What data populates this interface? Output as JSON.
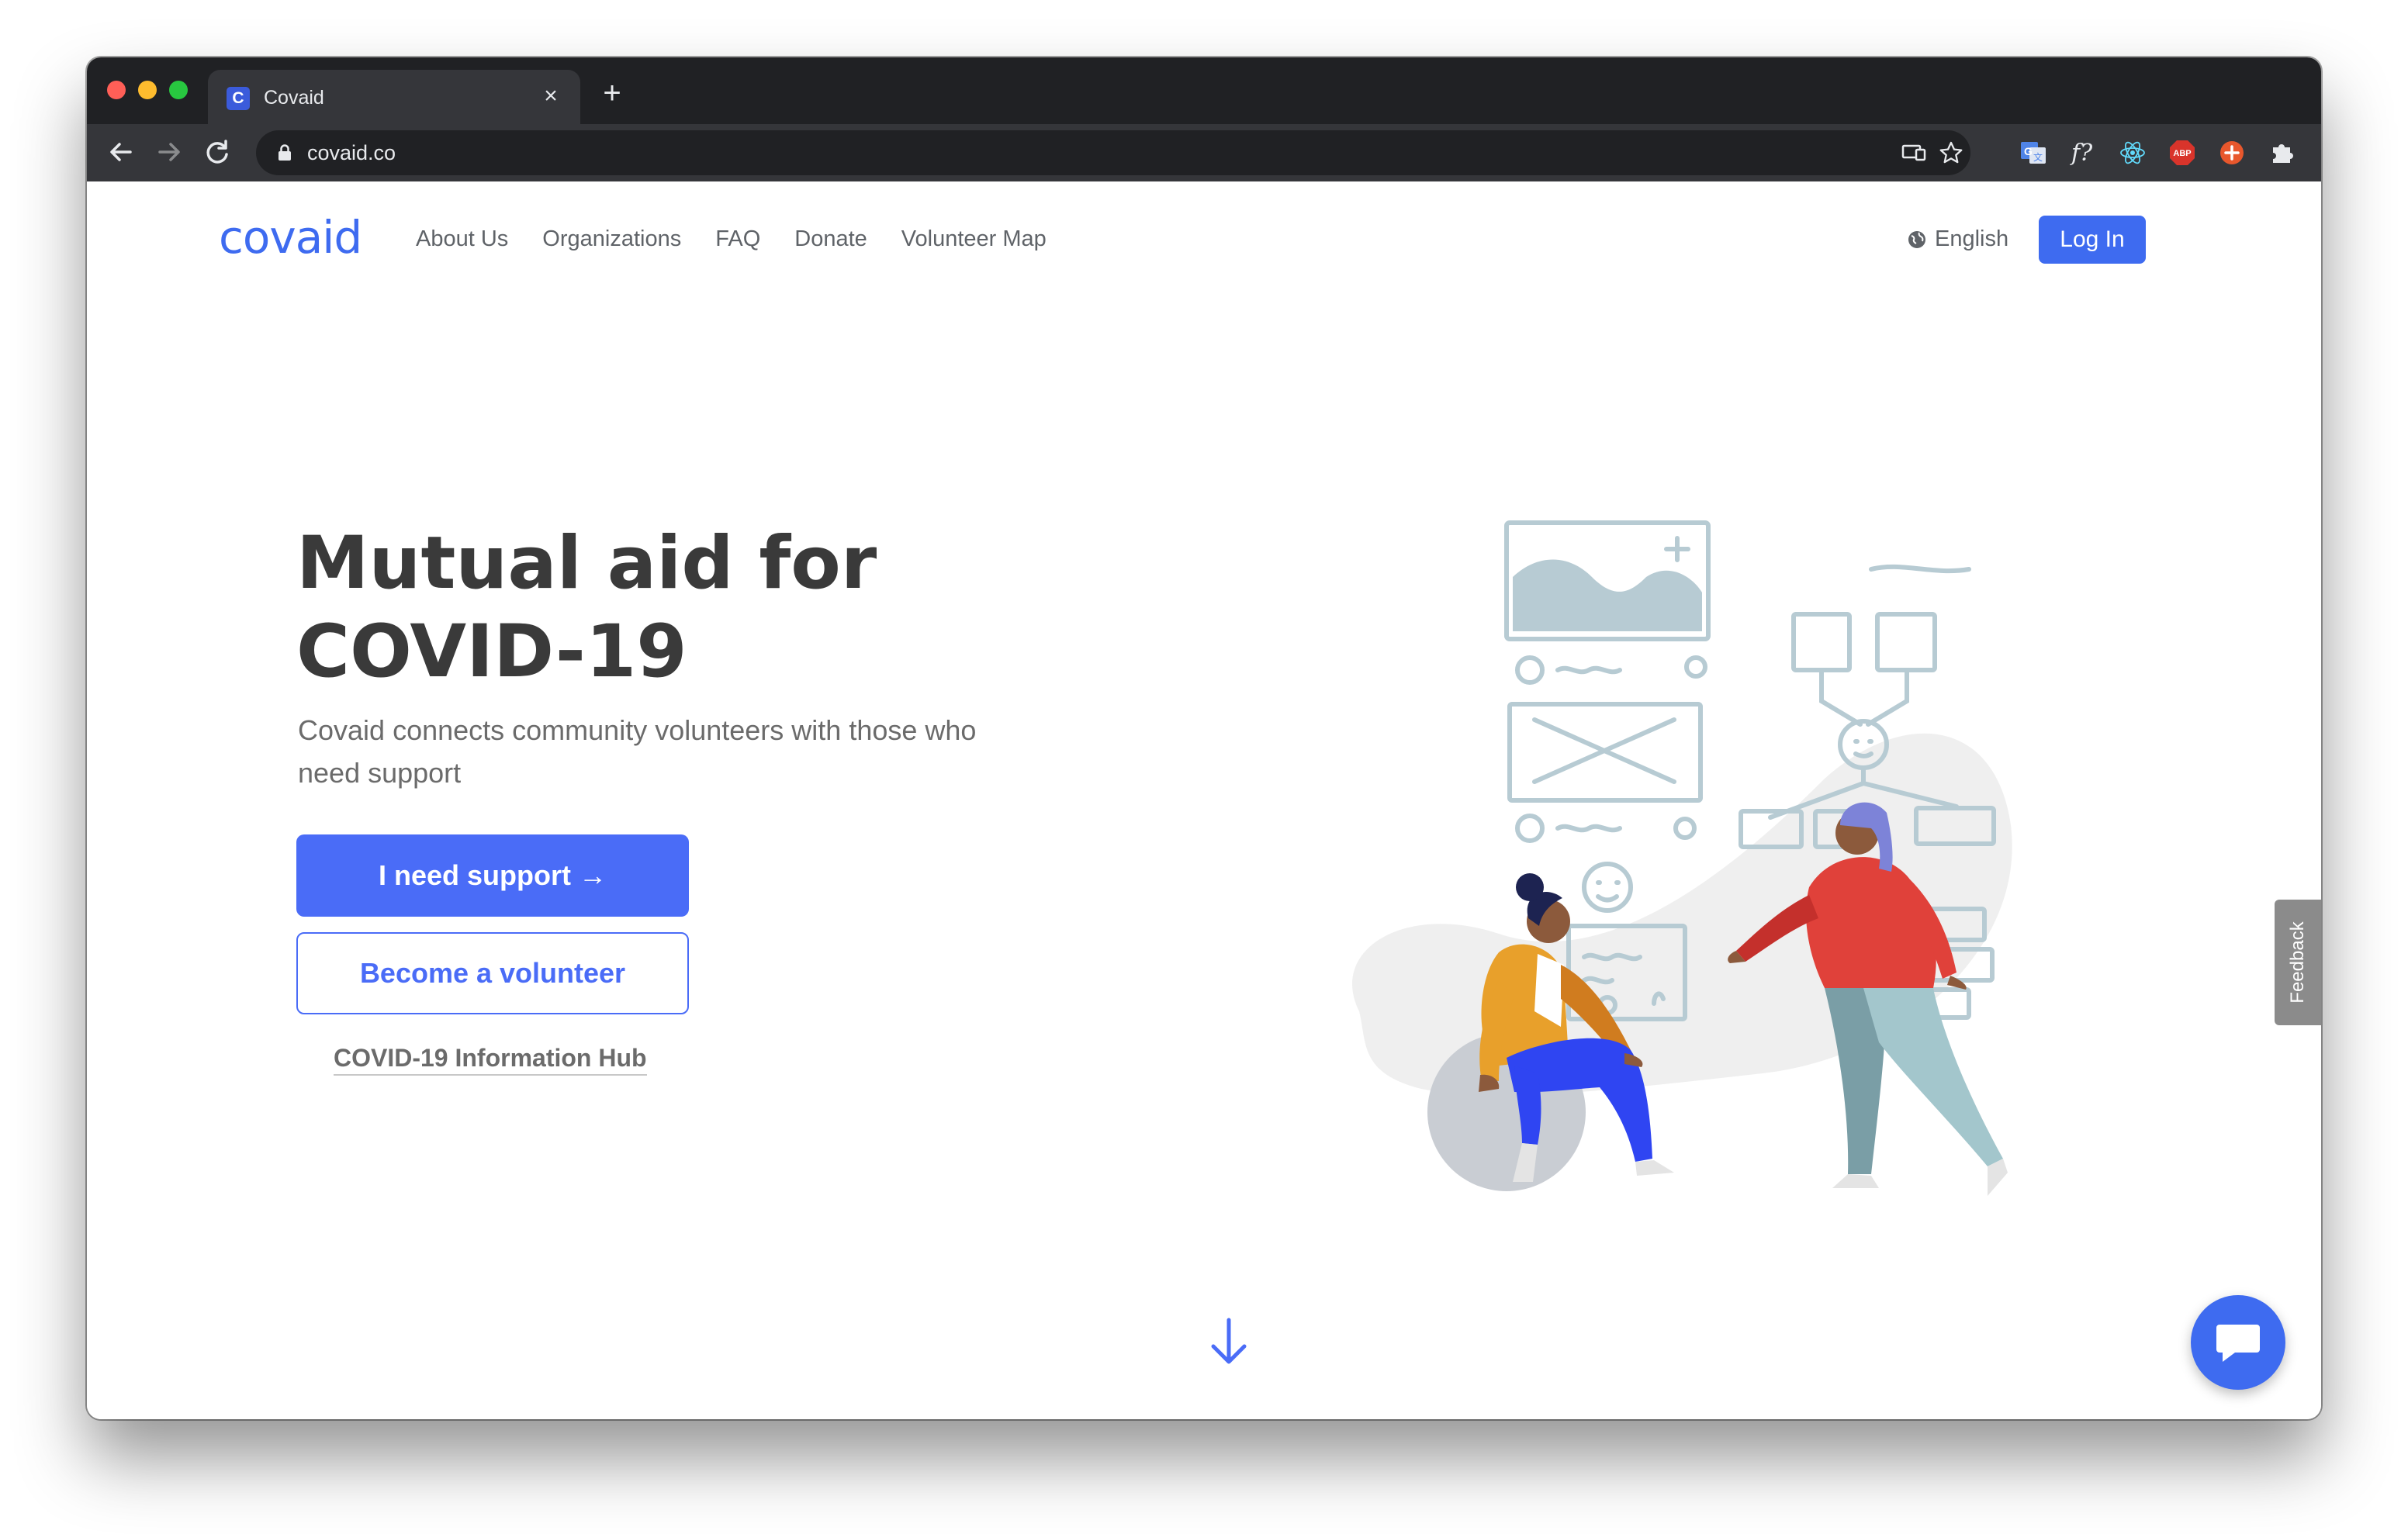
{
  "browser": {
    "tab": {
      "favicon_letter": "C",
      "title": "Covaid"
    },
    "url": "covaid.co",
    "extensions": [
      "cast-icon",
      "star-icon",
      "translate-icon",
      "f-icon",
      "react-icon",
      "abp-icon",
      "plus-ext-icon",
      "puzzle-icon",
      "avatar",
      "menu-icon"
    ],
    "abp_label": "ABP",
    "f_label": "f?"
  },
  "header": {
    "logo": "covaid",
    "nav": [
      "About Us",
      "Organizations",
      "FAQ",
      "Donate",
      "Volunteer Map"
    ],
    "language": "English",
    "login": "Log In"
  },
  "hero": {
    "title_line1": "Mutual aid for",
    "title_line2": "COVID-19",
    "subtitle": "Covaid connects community volunteers with those who need support",
    "primary_button": "I need support →",
    "secondary_button": "Become a volunteer",
    "info_link": "COVID-19 Information Hub"
  },
  "widgets": {
    "feedback": "Feedback"
  },
  "colors": {
    "accent": "#4a6cf7",
    "logo": "#3e6bf0",
    "chrome_dark": "#202124",
    "chrome_mid": "#35363a"
  }
}
